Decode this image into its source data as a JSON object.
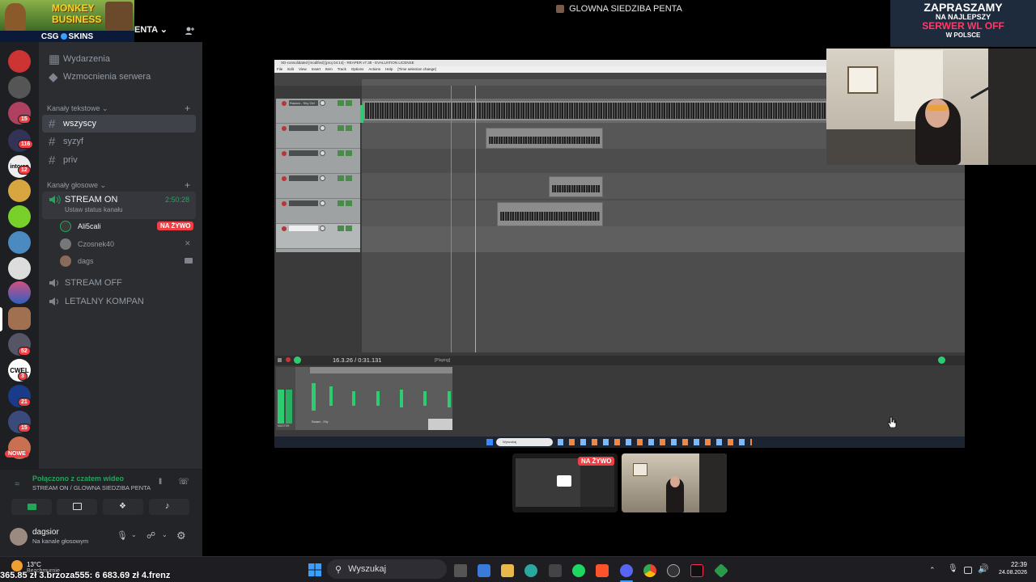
{
  "window": {
    "title": "GLOWNA SIEDZIBA PENTA"
  },
  "overlay": {
    "monkey_logo": "MONKEY BUSINESS",
    "csg_skins": "CSG",
    "csg_skins2": "SKINS",
    "promo": {
      "line1": "ZAPRASZAMY",
      "line2": "NA NAJLEPSZY",
      "line3": "SERWER WL OFF",
      "line4": "W POLSCE"
    }
  },
  "server": {
    "name_partial": "ENTA"
  },
  "servers_rail": {
    "badges": [
      "15",
      "116",
      "12",
      "52",
      "3",
      "21",
      "15"
    ],
    "new_label": "NOWE",
    "partial_text": "into:an",
    "cwel_label": "CWEL"
  },
  "channels": {
    "top_items": [
      {
        "label": "Wydarzenia"
      },
      {
        "label": "Wzmocnienia serwera"
      }
    ],
    "text_category": "Kanały tekstowe",
    "text_channels": [
      "wszyscy",
      "syzyf",
      "priv"
    ],
    "voice_category": "Kanały głosowe",
    "voice_channels": [
      {
        "label": "STREAM ON",
        "timer": "2:50:28",
        "status": "Ustaw status kanału"
      },
      {
        "label": "STREAM OFF"
      },
      {
        "label": "LETALNY KOMPAN"
      }
    ],
    "members": [
      {
        "name": "Ali5cali",
        "badge": "NA ŻYWO"
      },
      {
        "name": "Czosnek40"
      },
      {
        "name": "dags"
      }
    ]
  },
  "voice_connection": {
    "status": "Połączono z czatem wideo",
    "location": "STREAM ON / GLOWNA SIEDZIBA PENTA"
  },
  "user": {
    "name": "dagsior",
    "status": "Na kanale głosowym"
  },
  "reaper": {
    "title": "XD-consolidated [modified] [proj 04:14] - REAPER v7.38 - EVALUATION LICENSE",
    "menu": [
      "File",
      "Edit",
      "View",
      "Insert",
      "Item",
      "Track",
      "Options",
      "Actions",
      "Help",
      "[Time selection change]"
    ],
    "time": "16.3.26 / 0:31.131",
    "state": "[Playing]",
    "track1": "Radam - Shy Girl",
    "master": "MASTER",
    "mixer_track": "Radam - Shy",
    "search": "Wyszukaj"
  },
  "stream_tiles": {
    "live_badge": "NA ŻYWO"
  },
  "taskbar": {
    "weather": "13°C",
    "weather_desc": "Bezchmurnie",
    "search_placeholder": "Wyszukaj",
    "time": "22:39",
    "date": "24.08.2026"
  },
  "ticker": {
    "text": "365.85 zł 3.brzoza555: 6 683.69 zł 4.frenz"
  },
  "colors": {
    "discord_green": "#23a55a",
    "live_red": "#f23f43",
    "accent_blue": "#5865f2"
  }
}
